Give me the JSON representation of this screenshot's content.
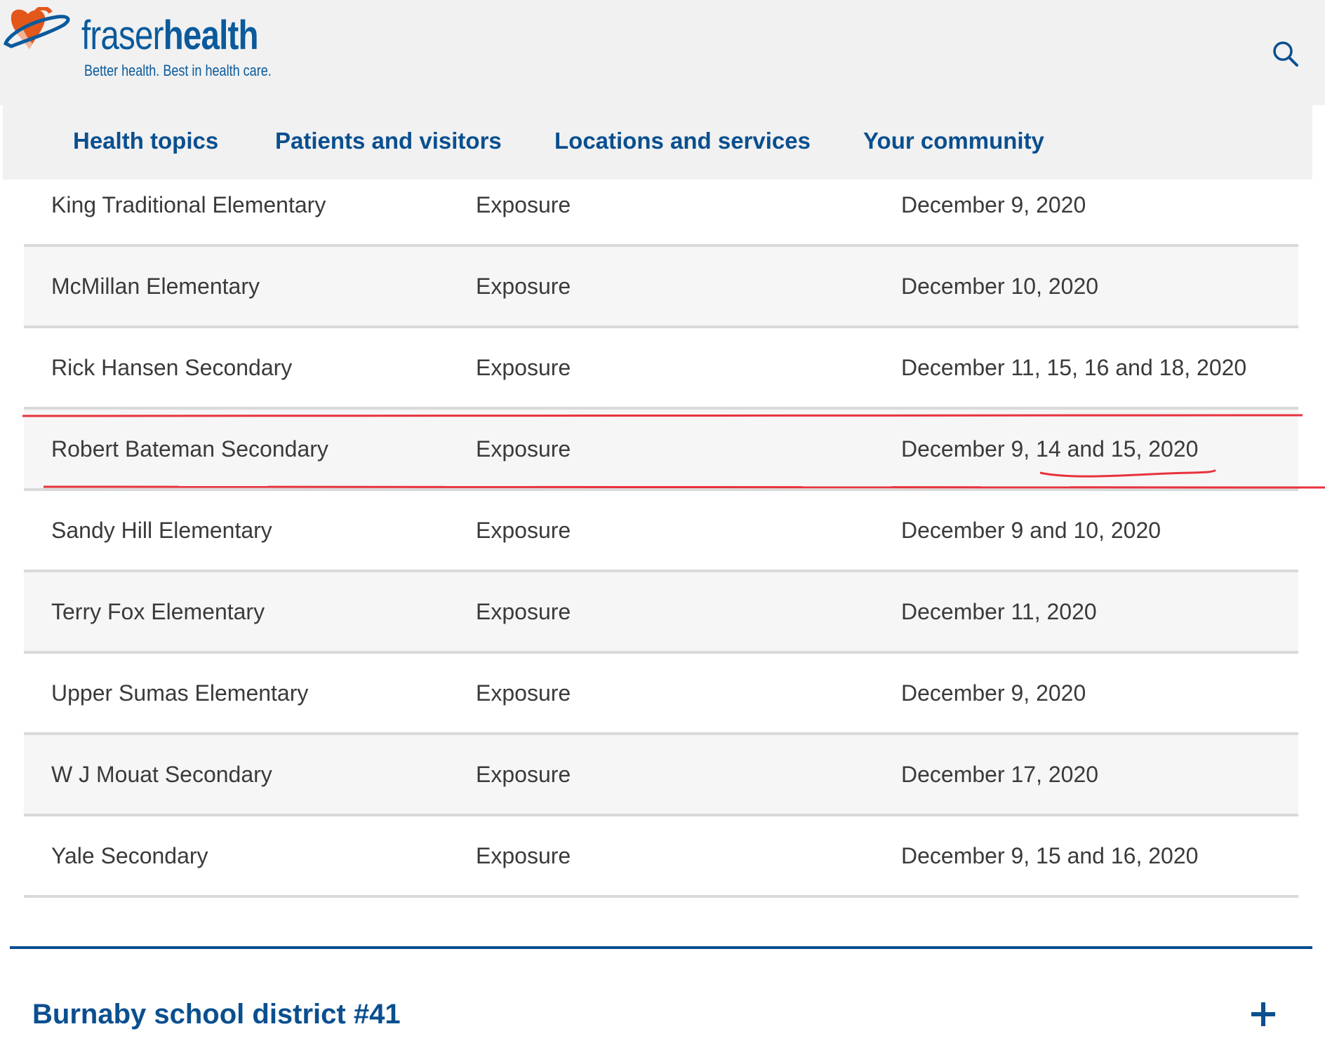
{
  "brand": {
    "name_light": "fraser",
    "name_bold": "health",
    "tagline": "Better health. Best in health care."
  },
  "header": {
    "search_icon": "search-icon"
  },
  "nav": {
    "items": [
      "Health topics",
      "Patients and visitors",
      "Locations and services",
      "Your community"
    ]
  },
  "table": {
    "rows": [
      {
        "school": "King Traditional Elementary",
        "type": "Exposure",
        "dates": "December 9, 2020"
      },
      {
        "school": "McMillan Elementary",
        "type": "Exposure",
        "dates": "December 10, 2020"
      },
      {
        "school": "Rick Hansen Secondary",
        "type": "Exposure",
        "dates": "December 11, 15, 16 and 18, 2020"
      },
      {
        "school": "Robert Bateman Secondary",
        "type": "Exposure",
        "dates": "December 9, 14 and 15, 2020"
      },
      {
        "school": "Sandy Hill Elementary",
        "type": "Exposure",
        "dates": "December 9 and 10, 2020"
      },
      {
        "school": "Terry Fox Elementary",
        "type": "Exposure",
        "dates": "December 11, 2020"
      },
      {
        "school": "Upper Sumas Elementary",
        "type": "Exposure",
        "dates": "December 9, 2020"
      },
      {
        "school": "W J Mouat Secondary",
        "type": "Exposure",
        "dates": "December 17,  2020"
      },
      {
        "school": "Yale Secondary",
        "type": "Exposure",
        "dates": "December 9, 15 and 16, 2020"
      }
    ]
  },
  "section": {
    "title": "Burnaby school district #41",
    "expand_icon": "plus-icon"
  },
  "colors": {
    "brand_blue": "#0a4f8f",
    "logo_orange": "#e4571b",
    "annotation_red": "#e8323c"
  }
}
